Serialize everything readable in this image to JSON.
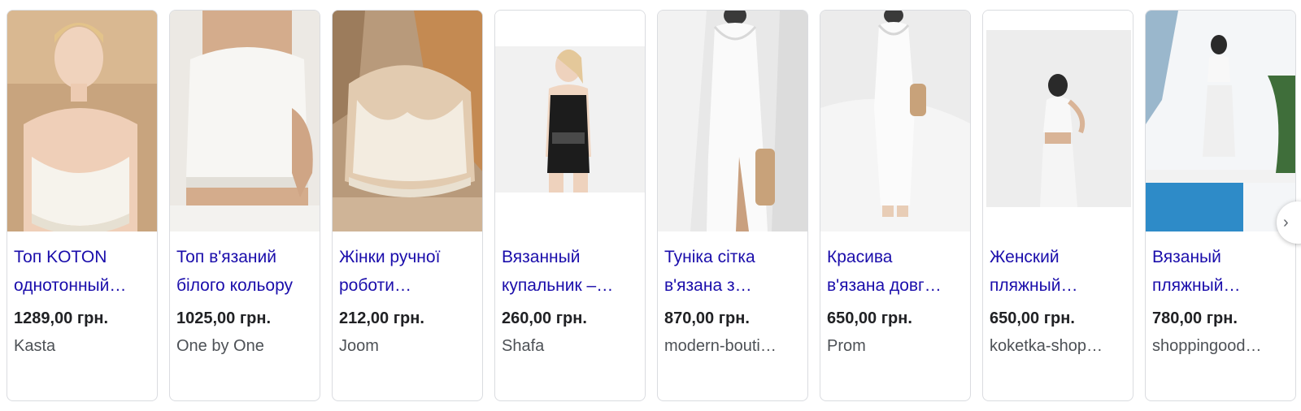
{
  "products": [
    {
      "title_line1": "Топ KOTON",
      "title_line2": "однотонный…",
      "price": "1289,00 грн.",
      "store": "Kasta",
      "image_icon": "crochet-top-photo"
    },
    {
      "title_line1": "Топ в'язаний",
      "title_line2": "білого кольору",
      "price": "1025,00 грн.",
      "store": "One by One",
      "image_icon": "knit-top-photo"
    },
    {
      "title_line1": "Жінки ручної",
      "title_line2": "роботи…",
      "price": "212,00 грн.",
      "store": "Joom",
      "image_icon": "crochet-bralette-photo"
    },
    {
      "title_line1": "Вязанный",
      "title_line2": "купальник –…",
      "price": "260,00 грн.",
      "store": "Shafa",
      "image_icon": "swimsuit-photo"
    },
    {
      "title_line1": "Туніка сітка",
      "title_line2": "в'язана з…",
      "price": "870,00 грн.",
      "store": "modern-bouti…",
      "image_icon": "mesh-dress-photo"
    },
    {
      "title_line1": "Красива",
      "title_line2": "в'язана довг…",
      "price": "650,00 грн.",
      "store": "Prom",
      "image_icon": "long-knit-dress-photo"
    },
    {
      "title_line1": "Женский",
      "title_line2": "пляжный…",
      "price": "650,00 грн.",
      "store": "koketka-shop…",
      "image_icon": "beach-set-photo"
    },
    {
      "title_line1": "Вязаный",
      "title_line2": "пляжный…",
      "price": "780,00 грн.",
      "store": "shoppingood…",
      "image_icon": "beach-skirt-photo"
    }
  ],
  "colors": {
    "title_link": "#1a0dab",
    "price": "#202124",
    "store": "#4d5156",
    "card_border": "#dadce0"
  },
  "next_button_icon": "chevron-right-icon"
}
